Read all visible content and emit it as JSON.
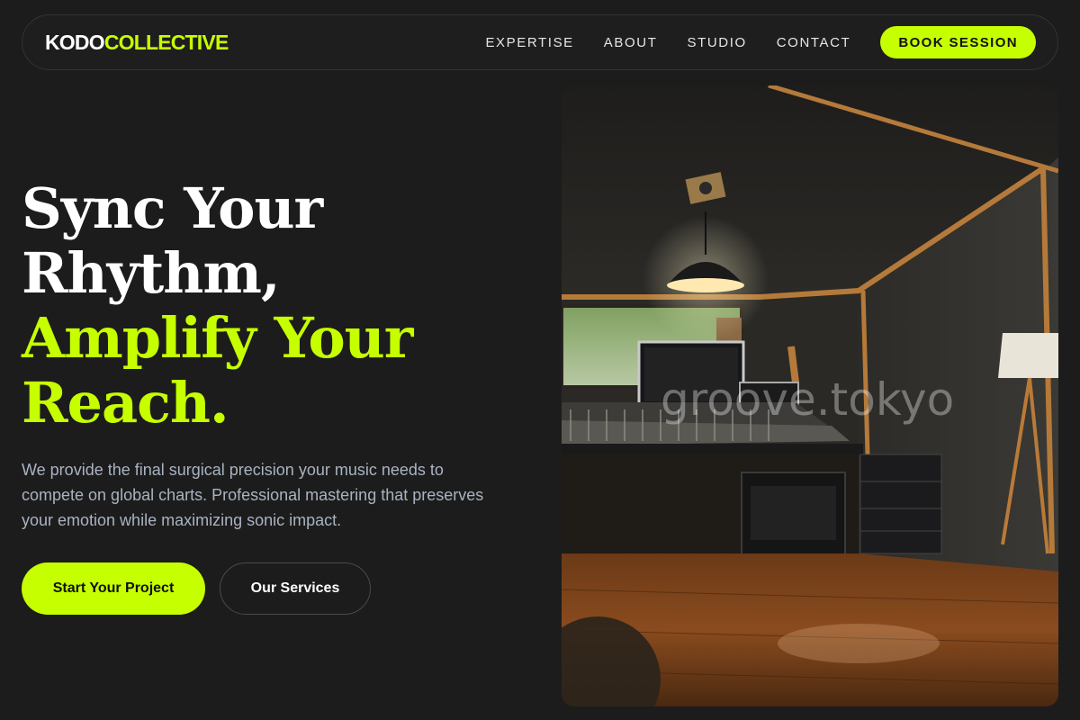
{
  "brand": {
    "part1": "KODO",
    "part2": "COLLECTIVE",
    "accent_color": "#c6ff00"
  },
  "nav": {
    "links": [
      "EXPERTISE",
      "ABOUT",
      "STUDIO",
      "CONTACT"
    ],
    "cta": "BOOK SESSION"
  },
  "hero": {
    "title_line1": "Sync Your",
    "title_line2": "Rhythm,",
    "title_line3": "Amplify Your",
    "title_line4": "Reach.",
    "description": "We provide the final surgical precision your music needs to compete on global charts. Professional mastering that preserves your emotion while maximizing sonic impact.",
    "primary_button": "Start Your Project",
    "secondary_button": "Our Services"
  },
  "image": {
    "subject": "recording studio interior with mixing console, pendant lamp, floor lamp, wooden floor",
    "watermark": "groove.tokyo"
  }
}
